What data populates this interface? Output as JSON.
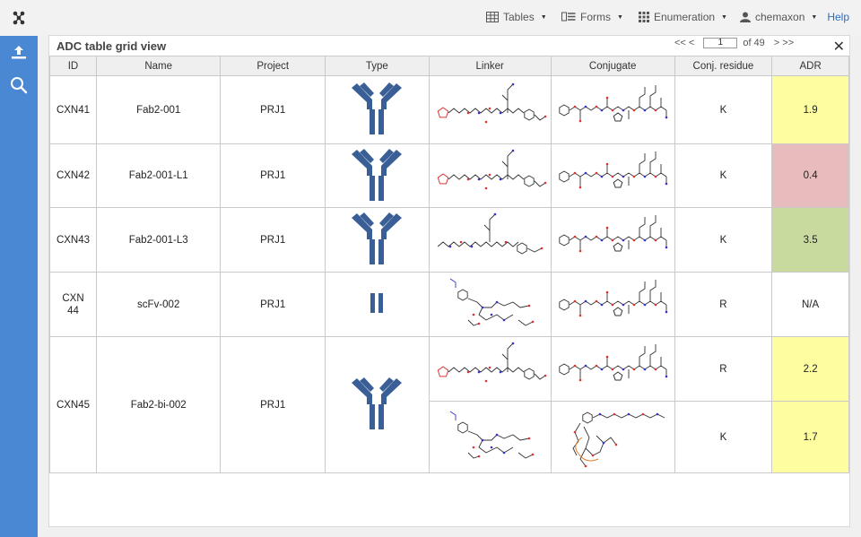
{
  "nav": {
    "menus": [
      {
        "label": "Tables",
        "icon": "table-icon"
      },
      {
        "label": "Forms",
        "icon": "form-icon"
      },
      {
        "label": "Enumeration",
        "icon": "grid-dots-icon"
      },
      {
        "label": "chemaxon",
        "icon": "user-icon"
      }
    ],
    "help": "Help"
  },
  "sidebar": {
    "items": [
      {
        "icon": "logo-icon"
      },
      {
        "icon": "upload-icon"
      },
      {
        "icon": "search-icon"
      }
    ]
  },
  "panel": {
    "title": "ADC table grid view",
    "pager": {
      "prev": "<< <",
      "page": "1",
      "of": "of 49",
      "next": "> >>"
    },
    "columns": [
      "ID",
      "Name",
      "Project",
      "Type",
      "Linker",
      "Conjugate",
      "Conj. residue",
      "ADR"
    ]
  },
  "rows": [
    {
      "id": "CXN41",
      "name": "Fab2-001",
      "project": "PRJ1",
      "residue": "K",
      "adr": "1.9",
      "adr_color": "#fefea0"
    },
    {
      "id": "CXN42",
      "name": "Fab2-001-L1",
      "project": "PRJ1",
      "residue": "K",
      "adr": "0.4",
      "adr_color": "#e8bcbc"
    },
    {
      "id": "CXN43",
      "name": "Fab2-001-L3",
      "project": "PRJ1",
      "residue": "K",
      "adr": "3.5",
      "adr_color": "#c8da9e"
    },
    {
      "id": "CXN 44",
      "name": "scFv-002",
      "project": "PRJ1",
      "residue": "R",
      "adr": "N/A",
      "adr_color": "#ffffff"
    },
    {
      "id": "CXN45",
      "name": "Fab2-bi-002",
      "project": "PRJ1",
      "residue": "R",
      "adr": "2.2",
      "adr_color": "#fefea0"
    },
    {
      "id": "",
      "name": "",
      "project": "",
      "residue": "K",
      "adr": "1.7",
      "adr_color": "#fefea0"
    }
  ],
  "colors": {
    "accent": "#4a88d4",
    "antibody": "#3a5f96",
    "link": "#2a6fc9"
  }
}
